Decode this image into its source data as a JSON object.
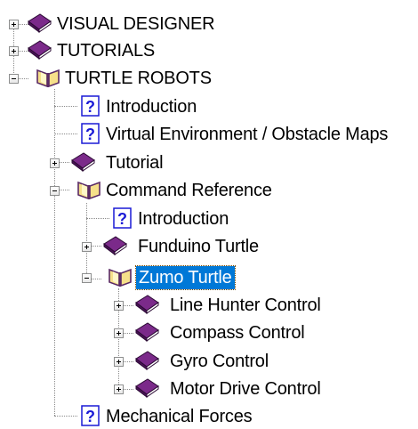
{
  "tree": {
    "nodes": [
      {
        "label": "VISUAL DESIGNER",
        "type": "book-closed",
        "expander": "plus"
      },
      {
        "label": "TUTORIALS",
        "type": "book-closed",
        "expander": "plus"
      },
      {
        "label": "TURTLE ROBOTS",
        "type": "book-open",
        "expander": "minus"
      },
      {
        "label": "Introduction",
        "type": "page"
      },
      {
        "label": "Virtual Environment / Obstacle Maps",
        "type": "page"
      },
      {
        "label": "Tutorial",
        "type": "book-closed",
        "expander": "plus"
      },
      {
        "label": "Command Reference",
        "type": "book-open",
        "expander": "minus"
      },
      {
        "label": "Introduction",
        "type": "page"
      },
      {
        "label": "Funduino Turtle",
        "type": "book-closed",
        "expander": "plus"
      },
      {
        "label": "Zumo Turtle",
        "type": "book-open",
        "expander": "minus",
        "selected": true
      },
      {
        "label": "Line Hunter Control",
        "type": "book-closed",
        "expander": "plus"
      },
      {
        "label": "Compass Control",
        "type": "book-closed",
        "expander": "plus"
      },
      {
        "label": "Gyro Control",
        "type": "book-closed",
        "expander": "plus"
      },
      {
        "label": "Motor Drive Control",
        "type": "book-closed",
        "expander": "plus"
      },
      {
        "label": "Mechanical Forces",
        "type": "page"
      }
    ]
  },
  "colors": {
    "selection": "#0078d7",
    "book_purple": "#6b1f7c",
    "help_blue": "#1a1ad6"
  }
}
